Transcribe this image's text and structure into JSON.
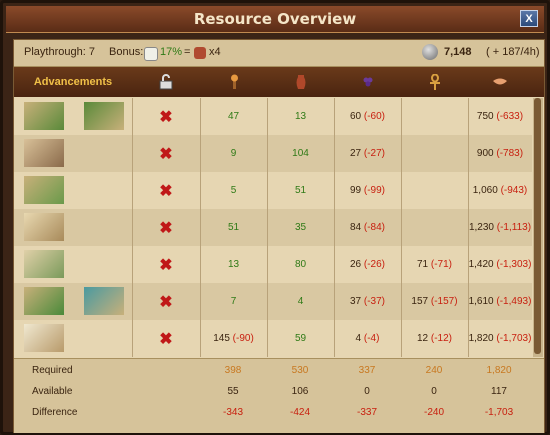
{
  "window": {
    "title": "Resource Overview",
    "close_label": "X"
  },
  "bonusbar": {
    "playthrough": "Playthrough: 7",
    "bonus_label": "Bonus:",
    "bonus_pct": "17%",
    "bonus_eq": "=",
    "bonus_mult": "x4",
    "coins": "7,148",
    "coins_rate": "( + 187/4h)"
  },
  "header": {
    "advancements": "Advancements"
  },
  "rows": [
    {
      "c1": "47",
      "c2": "13",
      "c3": "60",
      "c3d": "(-60)",
      "c4": "",
      "c4d": "",
      "c5": "750",
      "c5d": "(-633)"
    },
    {
      "c1": "9",
      "c2": "104",
      "c3": "27",
      "c3d": "(-27)",
      "c4": "",
      "c4d": "",
      "c5": "900",
      "c5d": "(-783)"
    },
    {
      "c1": "5",
      "c2": "51",
      "c3": "99",
      "c3d": "(-99)",
      "c4": "",
      "c4d": "",
      "c5": "1,060",
      "c5d": "(-943)"
    },
    {
      "c1": "51",
      "c2": "35",
      "c3": "84",
      "c3d": "(-84)",
      "c4": "",
      "c4d": "",
      "c5": "1,230",
      "c5d": "(-1,113)"
    },
    {
      "c1": "13",
      "c2": "80",
      "c3": "26",
      "c3d": "(-26)",
      "c4": "71",
      "c4d": "(-71)",
      "c5": "1,420",
      "c5d": "(-1,303)"
    },
    {
      "c1": "7",
      "c2": "4",
      "c3": "37",
      "c3d": "(-37)",
      "c4": "157",
      "c4d": "(-157)",
      "c5": "1,610",
      "c5d": "(-1,493)"
    },
    {
      "c1": "145",
      "c1d": "(-90)",
      "c2": "59",
      "c3": "4",
      "c3d": "(-4)",
      "c4": "12",
      "c4d": "(-12)",
      "c5": "1,820",
      "c5d": "(-1,703)"
    }
  ],
  "summary": {
    "required_label": "Required",
    "available_label": "Available",
    "difference_label": "Difference",
    "required": [
      "398",
      "530",
      "337",
      "240",
      "1,820"
    ],
    "available": [
      "55",
      "106",
      "0",
      "0",
      "117"
    ],
    "difference": [
      "-343",
      "-424",
      "-337",
      "-240",
      "-1,703"
    ]
  },
  "colors": {
    "accent": "#f0c048",
    "negative": "#c82010",
    "positive": "#2f7a16"
  },
  "icons": [
    "lock-open-icon",
    "torch-icon",
    "vase-icon",
    "grapes-icon",
    "ankh-icon",
    "handshake-icon",
    "coin-icon",
    "locked-x-icon"
  ]
}
